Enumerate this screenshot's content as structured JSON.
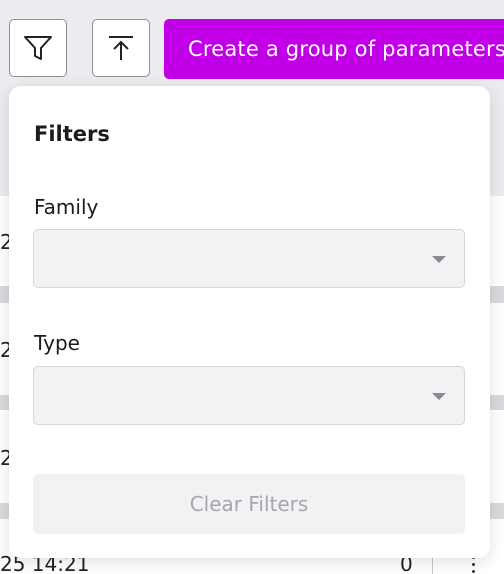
{
  "toolbar": {
    "filter_icon": "filter-icon",
    "export_icon": "upload-icon",
    "create_label": "Create a group of parameters",
    "accent_color": "#c200e8"
  },
  "background_table": {
    "row_fragments": [
      "2",
      "2",
      "2"
    ],
    "last_row": {
      "time": "25 14:21",
      "count": "0"
    }
  },
  "filters": {
    "title": "Filters",
    "family": {
      "label": "Family",
      "value": ""
    },
    "type": {
      "label": "Type",
      "value": ""
    },
    "clear_label": "Clear Filters"
  }
}
